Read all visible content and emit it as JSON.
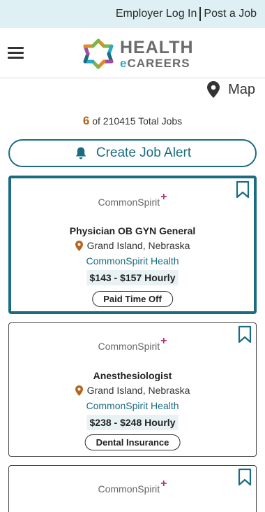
{
  "topbar": {
    "employer_login": "Employer Log In",
    "post_job": "Post a Job"
  },
  "logo": {
    "line1": "HEALTH",
    "line2_e": "e",
    "line2_rest": "CAREERS"
  },
  "map": {
    "label": "Map"
  },
  "results": {
    "count": "6",
    "of_text": "of 210415 Total Jobs"
  },
  "alert": {
    "label": "Create Job Alert"
  },
  "colors": {
    "accent": "#1a6c80",
    "count": "#b5651d",
    "brand_plus": "#b0317c"
  },
  "jobs": [
    {
      "company_logo": "CommonSpirit",
      "title": "Physician OB GYN General",
      "location": "Grand Island, Nebraska",
      "company": "CommonSpirit Health",
      "pay": "$143 - $157 Hourly",
      "benefit": "Paid Time Off"
    },
    {
      "company_logo": "CommonSpirit",
      "title": "Anesthesiologist",
      "location": "Grand Island, Nebraska",
      "company": "CommonSpirit Health",
      "pay": "$238 - $248 Hourly",
      "benefit": "Dental Insurance"
    },
    {
      "company_logo": "CommonSpirit"
    }
  ]
}
